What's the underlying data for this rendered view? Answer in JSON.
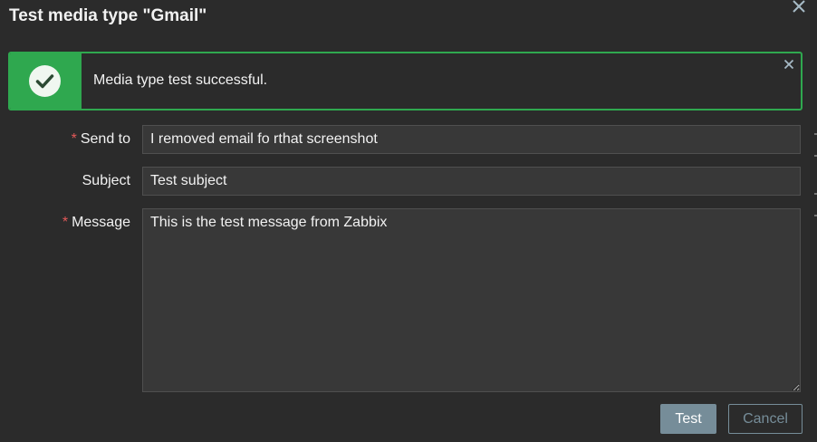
{
  "dialog": {
    "title": "Test media type \"Gmail\"",
    "close_icon": "close-icon"
  },
  "message": {
    "status": "success",
    "text": "Media type test successful.",
    "icon": "check-circle-icon",
    "close_icon": "close-icon",
    "accent_color": "#2fa84f"
  },
  "form": {
    "send_to": {
      "label": "Send to",
      "required": true,
      "value": "I removed email fo rthat screenshot"
    },
    "subject": {
      "label": "Subject",
      "required": false,
      "value": "Test subject"
    },
    "message": {
      "label": "Message",
      "required": true,
      "value": "This is the test message from Zabbix"
    }
  },
  "buttons": {
    "test_label": "Test",
    "cancel_label": "Cancel"
  },
  "colors": {
    "background": "#2b2b2b",
    "field_background": "#383838",
    "required_marker": "#e45959",
    "button": "#768d99"
  }
}
